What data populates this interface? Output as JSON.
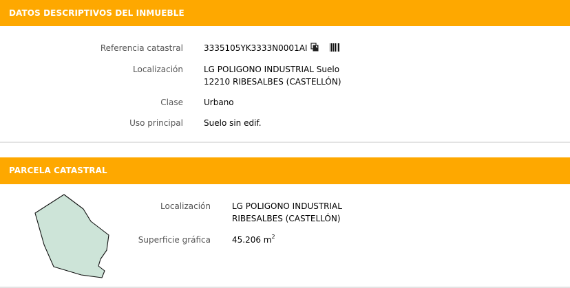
{
  "inmueble": {
    "header": "DATOS DESCRIPTIVOS DEL INMUEBLE",
    "referencia_label": "Referencia catastral",
    "referencia_value": "3335105YK3333N0001AI",
    "copy_icon": "copy-icon",
    "barcode_icon": "barcode-icon",
    "localizacion_label": "Localización",
    "localizacion_line1": "LG POLIGONO INDUSTRIAL Suelo",
    "localizacion_line2": "12210 RIBESALBES (CASTELLÓN)",
    "clase_label": "Clase",
    "clase_value": "Urbano",
    "uso_label": "Uso principal",
    "uso_value": "Suelo sin edif."
  },
  "parcela": {
    "header": "PARCELA CATASTRAL",
    "localizacion_label": "Localización",
    "localizacion_line1": "LG POLIGONO INDUSTRIAL",
    "localizacion_line2": "RIBESALBES (CASTELLÓN)",
    "superficie_label": "Superficie gráfica",
    "superficie_value": "45.206 m",
    "superficie_unit_exp": "2"
  },
  "colors": {
    "header_bg": "#fea800",
    "parcel_fill": "#cde4d8"
  }
}
